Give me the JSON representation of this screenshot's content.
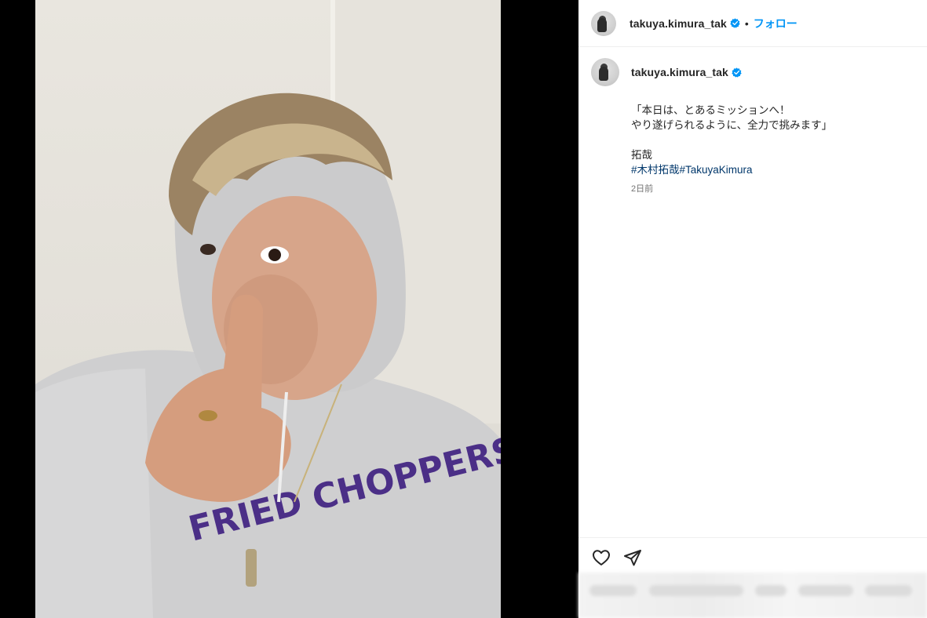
{
  "header": {
    "username": "takuya.kimura_tak",
    "separator": "•",
    "follow_label": "フォロー"
  },
  "post": {
    "username": "takuya.kimura_tak",
    "caption_line1": "「本日は、とあるミッションへ！",
    "caption_line2": "やり遂げられるように、全力で挑みます」",
    "signature": "拓哉",
    "hashtag1": "#木村拓哉",
    "hashtag2": "#TakuyaKimura",
    "timestamp": "2日前"
  },
  "photo": {
    "shirt_text": "FRIED CHOPPERS"
  },
  "colors": {
    "accent": "#0095f6",
    "hashtag": "#00376b",
    "verified": "#0095f6"
  },
  "icons": {
    "like": "heart-icon",
    "share": "paper-plane-icon",
    "verified": "verified-badge-icon"
  }
}
